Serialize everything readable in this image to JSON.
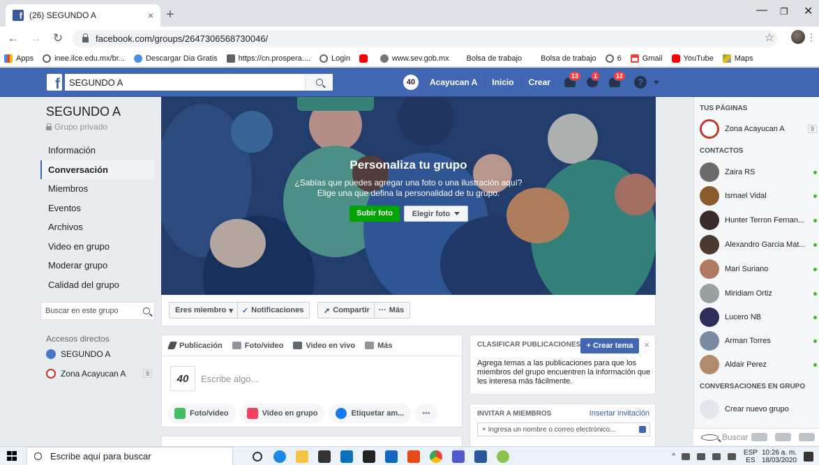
{
  "browser": {
    "tab_title": "(26) SEGUNDO A",
    "tab_close": "×",
    "new_tab": "+",
    "url": "facebook.com/groups/2647306568730046/",
    "bookmarks": [
      {
        "label": "Apps",
        "icon": "apps-grid-icon"
      },
      {
        "label": "inee.ilce.edu.mx/br...",
        "icon": "globe-icon"
      },
      {
        "label": "Descargar Dia Gratis",
        "icon": "blue-circle-icon"
      },
      {
        "label": "https://cn.prospera....",
        "icon": "document-icon"
      },
      {
        "label": "Login",
        "icon": "globe-icon"
      },
      {
        "label": "",
        "icon": "youtube-icon"
      },
      {
        "label": "www.sev.gob.mx",
        "icon": "gear-icon"
      },
      {
        "label": "Bolsa de trabajo",
        "icon": "none"
      },
      {
        "label": "Bolsa de trabajo",
        "icon": "none"
      },
      {
        "label": "6",
        "icon": "globe-icon"
      },
      {
        "label": "Gmail",
        "icon": "gmail-icon"
      },
      {
        "label": "YouTube",
        "icon": "youtube-icon"
      },
      {
        "label": "Maps",
        "icon": "maps-icon"
      }
    ]
  },
  "fb": {
    "search_value": "SEGUNDO A",
    "profile_name": "Acayucan A",
    "profile_avatar_text": "40",
    "nav_inicio": "Inicio",
    "nav_crear": "Crear",
    "badges": {
      "friends": "13",
      "messages": "1",
      "notifications": "12"
    },
    "help": "?"
  },
  "group": {
    "name": "SEGUNDO A",
    "privacy": "Grupo privado",
    "nav": [
      "Información",
      "Conversación",
      "Miembros",
      "Eventos",
      "Archivos",
      "Video en grupo",
      "Moderar grupo",
      "Calidad del grupo"
    ],
    "active_nav_index": 1,
    "search_placeholder": "Buscar en este grupo",
    "accesos_title": "Accesos directos",
    "accesos": [
      {
        "label": "SEGUNDO A",
        "count": ""
      },
      {
        "label": "Zona Acayucan A",
        "count": "9"
      }
    ]
  },
  "cover": {
    "title": "Personaliza tu grupo",
    "subtitle_line1": "¿Sabías que puedes agregar una foto o una ilustración aquí?",
    "subtitle_line2": "Elige una que defina la personalidad de tu grupo.",
    "upload_button": "Subir foto",
    "choose_button": "Elegir foto"
  },
  "actions": {
    "member": "Eres miembro",
    "notifications": "Notificaciones",
    "share": "Compartir",
    "more": "Más"
  },
  "composer": {
    "tabs": [
      "Publicación",
      "Foto/video",
      "Video en vivo",
      "Más"
    ],
    "placeholder": "Escribe algo...",
    "avatar_text": "40",
    "buttons": [
      "Foto/video",
      "Video en grupo",
      "Etiquetar am...",
      "•••"
    ]
  },
  "clasificar": {
    "heading": "CLASIFICAR PUBLICACIONES",
    "button": "+ Crear tema",
    "close": "×",
    "body": "Agrega temas a las publicaciones para que los miembros del grupo encuentren la información que les interesa más fácilmente."
  },
  "invitar": {
    "heading": "INVITAR A MIEMBROS",
    "link": "Insertar invitación",
    "input_placeholder": "+ Ingresa un nombre o correo electrónico..."
  },
  "chat": {
    "pages_heading": "TUS PÁGINAS",
    "page": {
      "name": "Zona Acayucan A",
      "count": "9"
    },
    "contacts_heading": "CONTACTOS",
    "contacts": [
      {
        "name": "Zaira RS",
        "color": "#6b6b6b"
      },
      {
        "name": "Ismael Vidal",
        "color": "#8a5a2b"
      },
      {
        "name": "Hunter Terron Fernan...",
        "color": "#3a2a2a"
      },
      {
        "name": "Alexandro Garcia Mat...",
        "color": "#4b3a30"
      },
      {
        "name": "Mari Suriano",
        "color": "#b07a60"
      },
      {
        "name": "Miridiam Ortiz",
        "color": "#9aa0a0"
      },
      {
        "name": "Lucero NB",
        "color": "#2e2e5a"
      },
      {
        "name": "Arman Torres",
        "color": "#7a8aa0"
      },
      {
        "name": "Aldair Perez",
        "color": "#b08a6a"
      }
    ],
    "group_convos_heading": "CONVERSACIONES EN GRUPO",
    "new_group": "Crear nuevo grupo",
    "search_placeholder": "Buscar"
  },
  "taskbar": {
    "search_placeholder": "Escribe aquí para buscar",
    "lang_top": "ESP",
    "lang_bottom": "ES",
    "time": "10:26 a. m.",
    "date": "18/03/2020"
  }
}
